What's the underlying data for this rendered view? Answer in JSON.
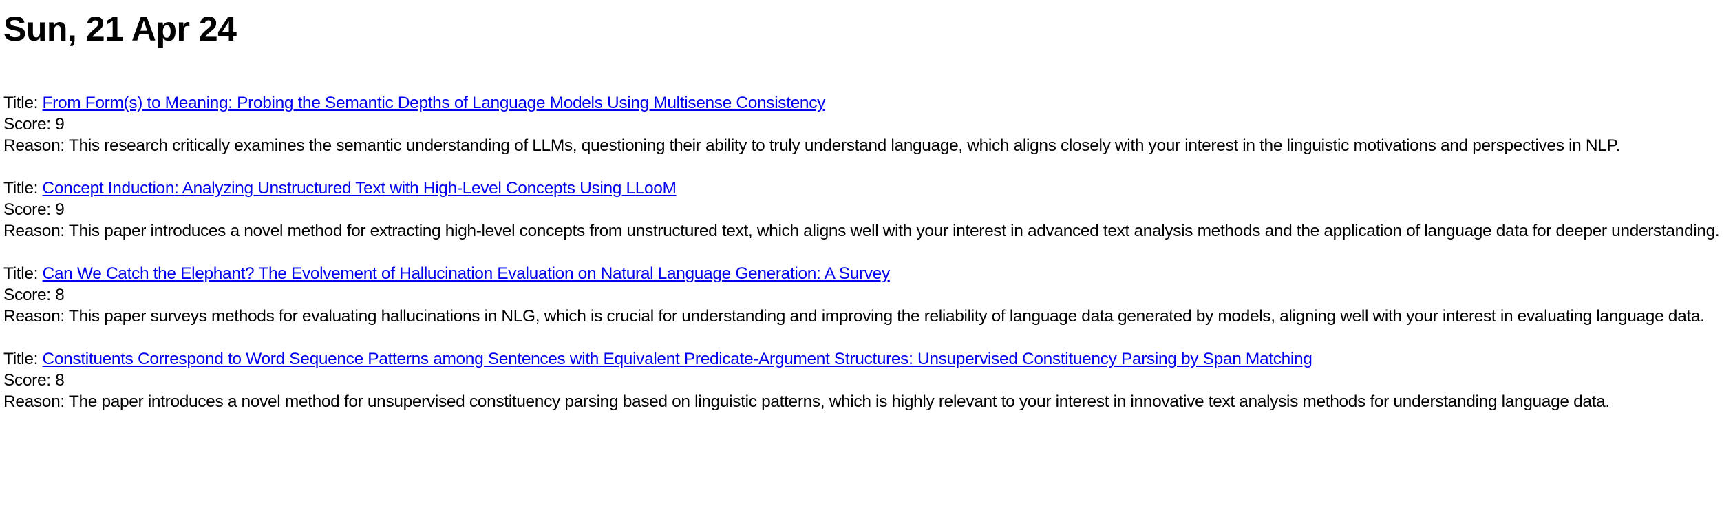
{
  "page_title": "Sun, 21 Apr 24",
  "labels": {
    "title": "Title: ",
    "score": "Score: ",
    "reason": "Reason: "
  },
  "papers": [
    {
      "title": "From Form(s) to Meaning: Probing the Semantic Depths of Language Models Using Multisense Consistency",
      "score": "9",
      "reason": "This research critically examines the semantic understanding of LLMs, questioning their ability to truly understand language, which aligns closely with your interest in the linguistic motivations and perspectives in NLP."
    },
    {
      "title": "Concept Induction: Analyzing Unstructured Text with High-Level Concepts Using LLooM",
      "score": "9",
      "reason": "This paper introduces a novel method for extracting high-level concepts from unstructured text, which aligns well with your interest in advanced text analysis methods and the application of language data for deeper understanding."
    },
    {
      "title": "Can We Catch the Elephant? The Evolvement of Hallucination Evaluation on Natural Language Generation: A Survey",
      "score": "8",
      "reason": "This paper surveys methods for evaluating hallucinations in NLG, which is crucial for understanding and improving the reliability of language data generated by models, aligning well with your interest in evaluating language data."
    },
    {
      "title": "Constituents Correspond to Word Sequence Patterns among Sentences with Equivalent Predicate-Argument Structures: Unsupervised Constituency Parsing by Span Matching",
      "score": "8",
      "reason": "The paper introduces a novel method for unsupervised constituency parsing based on linguistic patterns, which is highly relevant to your interest in innovative text analysis methods for understanding language data."
    }
  ]
}
